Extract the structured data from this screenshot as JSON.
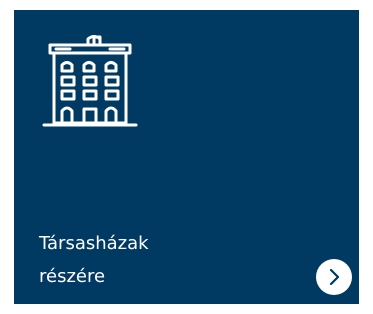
{
  "tile": {
    "title_line1": "Társasházak",
    "title_line2": "részére"
  },
  "icons": {
    "illustration": "apartment-building-icon",
    "action": "chevron-right-icon"
  },
  "colors": {
    "tile_background": "#003a63",
    "text": "#ffffff",
    "button_background": "#ffffff",
    "chevron": "#003a63"
  }
}
